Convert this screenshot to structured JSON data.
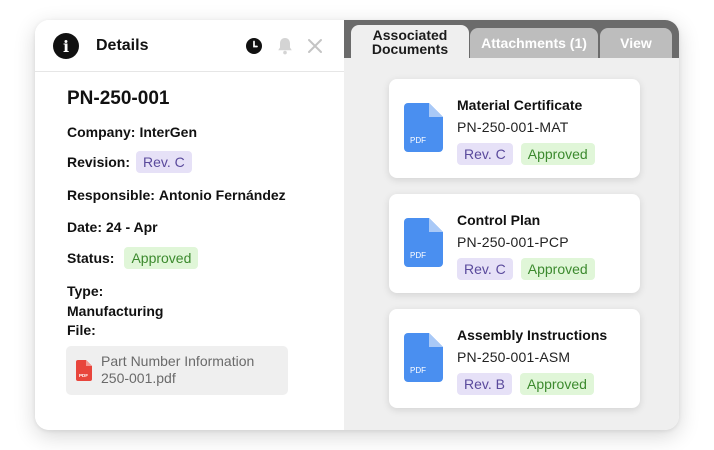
{
  "details": {
    "title": "Details",
    "doc_id": "PN-250-001",
    "company_label": "Company:",
    "company_value": "InterGen",
    "revision_label": "Revision:",
    "revision_value": "Rev. C",
    "responsible_label": "Responsible:",
    "responsible_value": "Antonio Fernández",
    "date_label": "Date:",
    "date_value": "24 - Apr",
    "status_label": "Status:",
    "status_value": "Approved",
    "type_label": "Type:",
    "type_value": "Manufacturing",
    "file_label": "File:",
    "file_name_line1": "Part Number Information",
    "file_name_line2": "250-001.pdf",
    "pdf_mini_text": "PDF"
  },
  "tabs": [
    {
      "label_line1": "Associated",
      "label_line2": "Documents"
    },
    {
      "label": "Attachments (1)"
    },
    {
      "label": "View"
    }
  ],
  "documents": [
    {
      "title": "Material Certificate",
      "code": "PN-250-001-MAT",
      "revision": "Rev. C",
      "status": "Approved",
      "icon_text": "PDF"
    },
    {
      "title": "Control Plan",
      "code": "PN-250-001-PCP",
      "revision": "Rev. C",
      "status": "Approved",
      "icon_text": "PDF"
    },
    {
      "title": "Assembly Instructions",
      "code": "PN-250-001-ASM",
      "revision": "Rev. B",
      "status": "Approved",
      "icon_text": "PDF"
    }
  ],
  "icons": [
    "info-icon",
    "clock-icon",
    "bell-icon",
    "close-icon",
    "pdf-file-icon"
  ],
  "colors": {
    "revision_badge_bg": "#e6e1f7",
    "revision_badge_text": "#5a4a9c",
    "approved_badge_bg": "#e0f6d8",
    "approved_badge_text": "#3c8a2e",
    "pdf_blue": "#4a8ff0",
    "pdf_red": "#e8453c",
    "tabbar": "#6b6b6b"
  }
}
